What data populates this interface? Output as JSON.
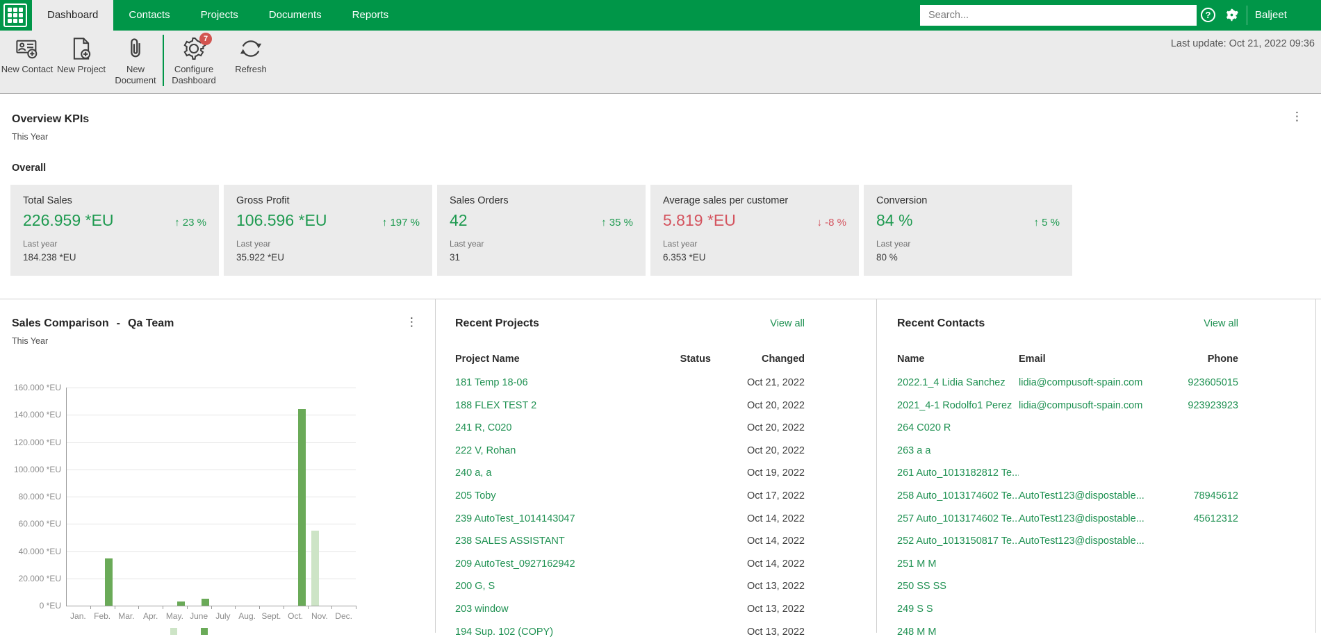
{
  "colors": {
    "brand_green": "#009648",
    "link_green": "#1f9152",
    "positive_green": "#1e9a50",
    "negative_red": "#d4545f",
    "badge_red": "#d25450",
    "bar_dark_green": "#6aaa58",
    "bar_light_green": "#cde4c6",
    "card_bg": "#ebebeb"
  },
  "topbar": {
    "tabs": [
      {
        "label": "Dashboard",
        "active": true
      },
      {
        "label": "Contacts",
        "active": false
      },
      {
        "label": "Projects",
        "active": false
      },
      {
        "label": "Documents",
        "active": false
      },
      {
        "label": "Reports",
        "active": false
      }
    ],
    "search_placeholder": "Search...",
    "user_name": "Baljeet Sandhu"
  },
  "toolbar": {
    "buttons": [
      {
        "label": "New Contact",
        "icon": "contact-card-plus-icon"
      },
      {
        "label": "New Project",
        "icon": "document-plus-icon"
      },
      {
        "label": "New Document",
        "icon": "paperclip-icon"
      },
      {
        "label": "Configure Dashboard",
        "icon": "gear-icon",
        "badge": "7",
        "divider_before": true
      },
      {
        "label": "Refresh",
        "icon": "refresh-icon"
      }
    ],
    "last_update": "Last update: Oct 21, 2022 09:36"
  },
  "kpi_panel": {
    "title": "Overview KPIs",
    "subtitle": "This Year",
    "group_label": "Overall",
    "last_year_label": "Last year",
    "cards": [
      {
        "label": "Total Sales",
        "value": "226.959 *EU",
        "delta": "23 %",
        "direction": "up",
        "positive": true,
        "last_year": "184.238 *EU"
      },
      {
        "label": "Gross Profit",
        "value": "106.596 *EU",
        "delta": "197 %",
        "direction": "up",
        "positive": true,
        "last_year": "35.922 *EU"
      },
      {
        "label": "Sales Orders",
        "value": "42",
        "delta": "35 %",
        "direction": "up",
        "positive": true,
        "last_year": "31"
      },
      {
        "label": "Average sales per customer",
        "value": "5.819 *EU",
        "delta": "-8 %",
        "direction": "down",
        "positive": false,
        "last_year": "6.353 *EU"
      },
      {
        "label": "Conversion",
        "value": "84 %",
        "delta": "5 %",
        "direction": "up",
        "positive": true,
        "last_year": "80 %"
      }
    ]
  },
  "sales_panel": {
    "title": "Sales Comparison",
    "separator": "-",
    "title_suffix": "Qa Team",
    "subtitle": "This Year"
  },
  "chart_data": {
    "type": "bar",
    "title": "Sales Comparison - Qa Team",
    "subtitle": "This Year",
    "categories": [
      "Jan.",
      "Feb.",
      "Mar.",
      "Apr.",
      "May.",
      "June",
      "July",
      "Aug.",
      "Sept.",
      "Oct.",
      "Nov.",
      "Dec."
    ],
    "series": [
      {
        "name": "dark-green-series",
        "shade": "dark",
        "color": "#6aaa58",
        "values": [
          0,
          34600,
          0,
          0,
          3000,
          5100,
          0,
          0,
          0,
          144200,
          0,
          0
        ]
      },
      {
        "name": "light-green-series",
        "shade": "light",
        "color": "#cde4c6",
        "values": [
          0,
          0,
          0,
          0,
          0,
          0,
          0,
          0,
          0,
          0,
          55000,
          0
        ]
      }
    ],
    "ylim": [
      0,
      160000
    ],
    "ytick_step": 20000,
    "yticks": [
      "160.000 *EU",
      "140.000 *EU",
      "120.000 *EU",
      "100.000 *EU",
      "80.000 *EU",
      "60.000 *EU",
      "40.000 *EU",
      "20.000 *EU",
      "0 *EU"
    ],
    "grid": true,
    "legend_position": "bottom (partially cut off)"
  },
  "recent_projects": {
    "title": "Recent Projects",
    "view_all": "View all",
    "columns": [
      "Project Name",
      "Status",
      "Changed"
    ],
    "rows": [
      {
        "name": "181 Temp 18-06",
        "status": "",
        "changed": "Oct 21, 2022"
      },
      {
        "name": "188 FLEX TEST 2",
        "status": "",
        "changed": "Oct 20, 2022"
      },
      {
        "name": "241 R, C020",
        "status": "",
        "changed": "Oct 20, 2022"
      },
      {
        "name": "222 V, Rohan",
        "status": "",
        "changed": "Oct 20, 2022"
      },
      {
        "name": "240 a, a",
        "status": "",
        "changed": "Oct 19, 2022"
      },
      {
        "name": "205 Toby",
        "status": "",
        "changed": "Oct 17, 2022"
      },
      {
        "name": "239 AutoTest_1014143047",
        "status": "",
        "changed": "Oct 14, 2022"
      },
      {
        "name": "238 SALES ASSISTANT",
        "status": "",
        "changed": "Oct 14, 2022"
      },
      {
        "name": "209 AutoTest_0927162942",
        "status": "",
        "changed": "Oct 14, 2022"
      },
      {
        "name": "200 G, S",
        "status": "",
        "changed": "Oct 13, 2022"
      },
      {
        "name": "203 window",
        "status": "",
        "changed": "Oct 13, 2022"
      },
      {
        "name": "194 Sup. 102 (COPY)",
        "status": "",
        "changed": "Oct 13, 2022"
      }
    ]
  },
  "recent_contacts": {
    "title": "Recent Contacts",
    "view_all": "View all",
    "columns": [
      "Name",
      "Email",
      "Phone"
    ],
    "rows": [
      {
        "name": "2022.1_4 Lidia Sanchez",
        "email": "lidia@compusoft-spain.com",
        "phone": "923605015"
      },
      {
        "name": "2021_4-1 Rodolfo1 Perez",
        "email": "lidia@compusoft-spain.com",
        "phone": "923923923"
      },
      {
        "name": "264 C020 R",
        "email": "",
        "phone": ""
      },
      {
        "name": "263 a a",
        "email": "",
        "phone": ""
      },
      {
        "name": "261 Auto_1013182812 Te...",
        "email": "",
        "phone": ""
      },
      {
        "name": "258 Auto_1013174602 Te...",
        "email": "AutoTest123@dispostable...",
        "phone": "78945612"
      },
      {
        "name": "257 Auto_1013174602 Te...",
        "email": "AutoTest123@dispostable...",
        "phone": "45612312"
      },
      {
        "name": "252 Auto_1013150817 Te...",
        "email": "AutoTest123@dispostable...",
        "phone": ""
      },
      {
        "name": "251 M M",
        "email": "",
        "phone": ""
      },
      {
        "name": "250 SS SS",
        "email": "",
        "phone": ""
      },
      {
        "name": "249 S S",
        "email": "",
        "phone": ""
      },
      {
        "name": "248 M M",
        "email": "",
        "phone": ""
      }
    ]
  }
}
